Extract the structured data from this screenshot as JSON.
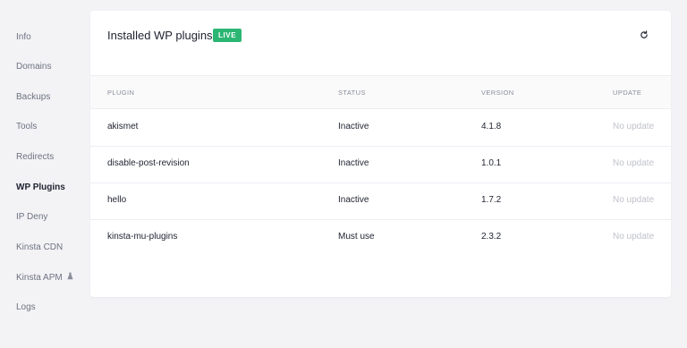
{
  "sidebar": {
    "items": [
      {
        "label": "Info"
      },
      {
        "label": "Domains"
      },
      {
        "label": "Backups"
      },
      {
        "label": "Tools"
      },
      {
        "label": "Redirects"
      },
      {
        "label": "WP Plugins"
      },
      {
        "label": "IP Deny"
      },
      {
        "label": "Kinsta CDN"
      },
      {
        "label": "Kinsta APM"
      },
      {
        "label": "Logs"
      }
    ],
    "active": "WP Plugins",
    "apm_icon": "flask-icon"
  },
  "card": {
    "title": "Installed WP plugins",
    "badge": "LIVE",
    "badge_color": "#2bb673",
    "refresh_icon": "refresh-icon"
  },
  "table": {
    "columns": [
      "PLUGIN",
      "STATUS",
      "VERSION",
      "UPDATE"
    ],
    "rows": [
      {
        "plugin": "akismet",
        "status": "Inactive",
        "version": "4.1.8",
        "update": "No update"
      },
      {
        "plugin": "disable-post-revision",
        "status": "Inactive",
        "version": "1.0.1",
        "update": "No update"
      },
      {
        "plugin": "hello",
        "status": "Inactive",
        "version": "1.7.2",
        "update": "No update"
      },
      {
        "plugin": "kinsta-mu-plugins",
        "status": "Must use",
        "version": "2.3.2",
        "update": "No update"
      }
    ]
  }
}
